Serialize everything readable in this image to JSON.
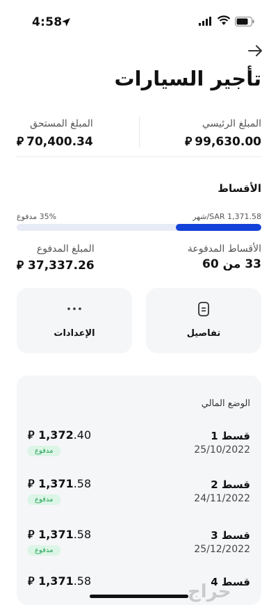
{
  "status": {
    "time": "4:58"
  },
  "header": {
    "title": "تأجير السيارات"
  },
  "summary": {
    "principal_label": "المبلغ الرئيسي",
    "principal_value": "99,630.00",
    "due_label": "المبلغ المستحق",
    "due_value": "70,400.34",
    "currency_symbol": "⃁"
  },
  "installments": {
    "title": "الأقساط",
    "paid_percent_text": "35% مدفوع",
    "monthly_text": "SAR 1,371.58/شهر",
    "progress_fraction": 0.35,
    "paid_count_label": "الأقساط المدفوعة",
    "paid_count_value": "33 من 60",
    "paid_amount_label": "المبلغ المدفوع",
    "paid_amount_value": "37,337.26"
  },
  "actions": [
    {
      "label": "تفاصيل",
      "icon": "document-icon"
    },
    {
      "label": "الإعدادات",
      "icon": "more-dots-icon"
    }
  ],
  "financial": {
    "title": "الوضع المالي",
    "rows": [
      {
        "name": "قسط 1",
        "date": "25/10/2022",
        "amount_int": "1,372",
        "amount_dec": ".40",
        "status": "مدفوع"
      },
      {
        "name": "قسط 2",
        "date": "24/11/2022",
        "amount_int": "1,371",
        "amount_dec": ".58",
        "status": "مدفوع"
      },
      {
        "name": "قسط 3",
        "date": "25/12/2022",
        "amount_int": "1,371",
        "amount_dec": ".58",
        "status": "مدفوع"
      },
      {
        "name": "قسط 4",
        "date": "",
        "amount_int": "1,371",
        "amount_dec": ".58",
        "status": ""
      }
    ]
  },
  "colors": {
    "accent": "#1342d8",
    "paid_badge_bg": "#dcf5e6",
    "paid_badge_text": "#21a055"
  },
  "watermark": "حراج"
}
